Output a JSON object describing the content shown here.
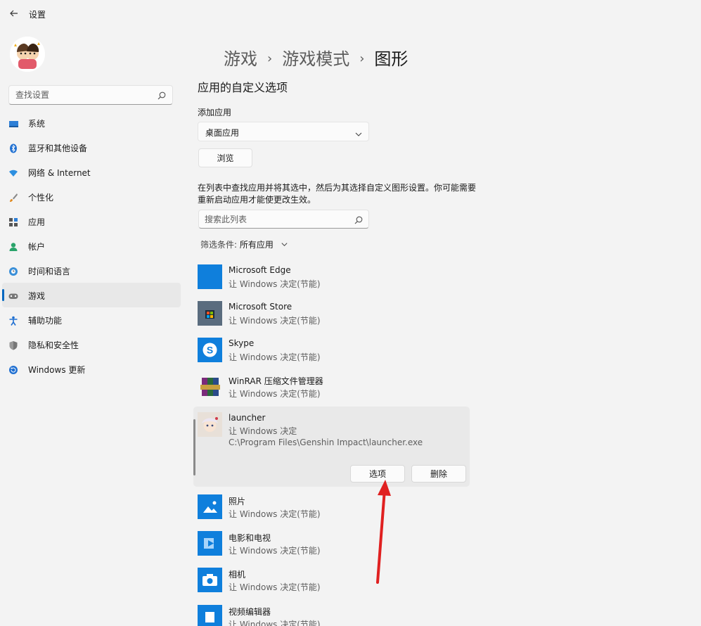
{
  "window": {
    "title": "设置"
  },
  "sidebar": {
    "search_placeholder": "查找设置",
    "items": [
      {
        "label": "系统",
        "icon": "system-icon"
      },
      {
        "label": "蓝牙和其他设备",
        "icon": "bluetooth-icon"
      },
      {
        "label": "网络 & Internet",
        "icon": "wifi-icon"
      },
      {
        "label": "个性化",
        "icon": "brush-icon"
      },
      {
        "label": "应用",
        "icon": "apps-icon"
      },
      {
        "label": "帐户",
        "icon": "account-icon"
      },
      {
        "label": "时间和语言",
        "icon": "globe-clock-icon"
      },
      {
        "label": "游戏",
        "icon": "gamepad-icon",
        "active": true
      },
      {
        "label": "辅助功能",
        "icon": "accessibility-icon"
      },
      {
        "label": "隐私和安全性",
        "icon": "shield-icon"
      },
      {
        "label": "Windows 更新",
        "icon": "update-icon"
      }
    ]
  },
  "breadcrumb": {
    "items": [
      "游戏",
      "游戏模式",
      "图形"
    ],
    "separator": "›"
  },
  "main": {
    "section_title": "应用的自定义选项",
    "add_app_label": "添加应用",
    "app_type_selected": "桌面应用",
    "browse_label": "浏览",
    "description": "在列表中查找应用并将其选中，然后为其选择自定义图形设置。你可能需要重新启动应用才能使更改生效。",
    "list_search_placeholder": "搜索此列表",
    "filter_label": "筛选条件:",
    "filter_value": "所有应用"
  },
  "apps": [
    {
      "name": "Microsoft Edge",
      "status": "让 Windows 决定(节能)",
      "icon": "edge-icon"
    },
    {
      "name": "Microsoft Store",
      "status": "让 Windows 决定(节能)",
      "icon": "store-icon"
    },
    {
      "name": "Skype",
      "status": "让 Windows 决定(节能)",
      "icon": "skype-icon"
    },
    {
      "name": "WinRAR 压缩文件管理器",
      "status": "让 Windows 决定(节能)",
      "icon": "winrar-icon"
    },
    {
      "name": "launcher",
      "status": "让 Windows 决定",
      "path": "C:\\Program Files\\Genshin Impact\\launcher.exe",
      "icon": "launcher-icon",
      "options_label": "选项",
      "delete_label": "删除"
    },
    {
      "name": "照片",
      "status": "让 Windows 决定(节能)",
      "icon": "photos-icon"
    },
    {
      "name": "电影和电视",
      "status": "让 Windows 决定(节能)",
      "icon": "movies-icon"
    },
    {
      "name": "相机",
      "status": "让 Windows 决定(节能)",
      "icon": "camera-icon"
    },
    {
      "name": "视频编辑器",
      "status": "让 Windows 决定(节能)",
      "icon": "video-editor-icon"
    }
  ],
  "colors": {
    "accent": "#0067c0",
    "app_tile_blue": "#0078d4",
    "arrow_red": "#e02020"
  }
}
